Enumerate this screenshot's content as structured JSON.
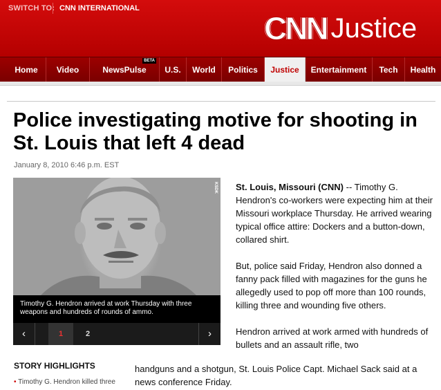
{
  "header": {
    "switch_label": "SWITCH TO:",
    "switch_link": "CNN INTERNATIONAL",
    "logo_brand": "CNN",
    "logo_section": "Justice"
  },
  "nav": {
    "items": [
      {
        "label": "Home"
      },
      {
        "label": "Video"
      },
      {
        "label": "NewsPulse",
        "badge": "BETA"
      },
      {
        "label": "U.S."
      },
      {
        "label": "World"
      },
      {
        "label": "Politics"
      },
      {
        "label": "Justice",
        "active": true
      },
      {
        "label": "Entertainment"
      },
      {
        "label": "Tech"
      },
      {
        "label": "Health"
      }
    ]
  },
  "article": {
    "headline": "Police investigating motive for shooting in St. Louis that left 4 dead",
    "timestamp": "January 8, 2010 6:46 p.m. EST",
    "dateline": "St. Louis, Missouri (CNN)",
    "para1_rest": " -- Timothy G. Hendron's co-workers were expecting him at their Missouri workplace Thursday. He arrived wearing typical office attire: Dockers and a button-down, collared shirt.",
    "para2": "But, police said Friday, Hendron also donned a fanny pack filled with magazines for the guns he allegedly used to pop off more than 100 rounds, killing three and wounding five others.",
    "para3_start": "Hendron arrived at work armed with hundreds of bullets and an assault rifle, two",
    "para3_rest": "handguns and a shotgun, St. Louis Police Capt. Michael Sack said at a news conference Friday."
  },
  "gallery": {
    "credit": "KSDK",
    "caption": "Timothy G. Hendron arrived at work Thursday with three weapons and hundreds of rounds of ammo.",
    "prev_icon": "chevron-left-icon",
    "next_icon": "chevron-right-icon",
    "prev_glyph": "‹",
    "next_glyph": "›",
    "pages": [
      "1",
      "2"
    ],
    "current_page": "1"
  },
  "highlights": {
    "title": "STORY HIGHLIGHTS",
    "bullet": "•",
    "first_item": "Timothy G. Hendron killed three"
  },
  "colors": {
    "brand_red": "#c00000",
    "nav_dark": "#8a0000",
    "active_tab_bg": "#f0f0f0"
  }
}
